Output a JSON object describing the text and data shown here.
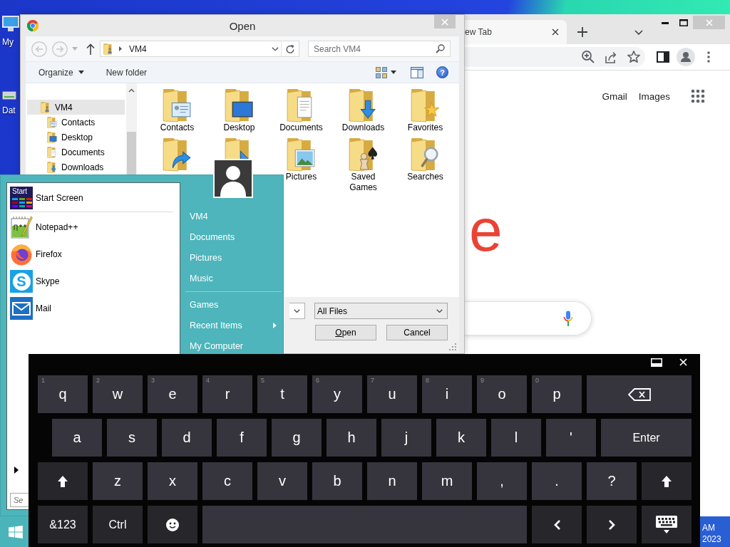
{
  "desktop": {
    "icons": [
      {
        "label": "My",
        "kind": "monitor"
      },
      {
        "label": "Dat",
        "kind": "drive"
      }
    ]
  },
  "dialog": {
    "title": "Open",
    "nav": [
      {
        "kind": "back",
        "disabled": true
      },
      {
        "kind": "forward",
        "disabled": true
      },
      {
        "kind": "history",
        "disabled": true
      },
      {
        "kind": "up",
        "disabled": false
      }
    ],
    "address": {
      "crumbs": [
        "VM4"
      ]
    },
    "search": {
      "placeholder": "Search VM4"
    },
    "toolbar": {
      "organize": "Organize",
      "new_folder": "New folder",
      "help": "?"
    },
    "tree": [
      {
        "label": "VM4",
        "kind": "person",
        "selected": true,
        "children": [
          {
            "label": "Contacts",
            "kind": "card",
            "selected": false
          },
          {
            "label": "Desktop",
            "kind": "screen",
            "selected": false
          },
          {
            "label": "Documents",
            "kind": "pages",
            "selected": false
          },
          {
            "label": "Downloads",
            "kind": "arrow-down",
            "selected": false
          }
        ]
      }
    ],
    "folders": [
      {
        "label": "Contacts",
        "kind": "card"
      },
      {
        "label": "Desktop",
        "kind": "screen"
      },
      {
        "label": "Documents",
        "kind": "pages"
      },
      {
        "label": "Downloads",
        "kind": "arrow-down"
      },
      {
        "label": "Favorites",
        "kind": "star"
      },
      {
        "kind": "arrow-curve"
      },
      {
        "kind": "cursor"
      },
      {
        "label": "Pictures",
        "kind": "photo"
      },
      {
        "label": "Saved Games",
        "kind": "chess"
      },
      {
        "label": "Searches",
        "kind": "magnifier"
      }
    ],
    "file_type": "All Files",
    "buttons": [
      {
        "label": "Open",
        "mnemonic": true
      },
      {
        "label": "Cancel",
        "mnemonic": false
      }
    ]
  },
  "browser": {
    "tab": "ew Tab",
    "links": [
      "Gmail",
      "Images"
    ],
    "logo": "e"
  },
  "start_menu": {
    "pinned": [
      [
        {
          "label": "Start Screen",
          "kind": "tiles",
          "icon_text": "Start"
        }
      ],
      [
        {
          "label": "Notepad++",
          "kind": "notepad"
        },
        {
          "label": "Firefox",
          "kind": "globe"
        },
        {
          "label": "Skype",
          "kind": "letter",
          "icon_text": "S"
        },
        {
          "label": "Mail",
          "kind": "envelope"
        }
      ]
    ],
    "search": {
      "placeholder": "Se"
    },
    "places": [
      [
        {
          "label": "VM4",
          "submenu": false
        },
        {
          "label": "Documents",
          "submenu": false
        },
        {
          "label": "Pictures",
          "submenu": false
        },
        {
          "label": "Music",
          "submenu": false
        }
      ],
      [
        {
          "label": "Games",
          "submenu": false
        },
        {
          "label": "Recent Items",
          "submenu": true
        },
        {
          "label": "My Computer",
          "submenu": false
        }
      ]
    ]
  },
  "keyboard": {
    "rows": [
      [
        {
          "label": "q",
          "hint": "1",
          "kind": "char"
        },
        {
          "label": "w",
          "hint": "2",
          "kind": "char"
        },
        {
          "label": "e",
          "hint": "3",
          "kind": "char"
        },
        {
          "label": "r",
          "hint": "4",
          "kind": "char"
        },
        {
          "label": "t",
          "hint": "5",
          "kind": "char"
        },
        {
          "label": "y",
          "hint": "6",
          "kind": "char"
        },
        {
          "label": "u",
          "hint": "7",
          "kind": "char"
        },
        {
          "label": "i",
          "hint": "8",
          "kind": "char"
        },
        {
          "label": "o",
          "hint": "9",
          "kind": "char"
        },
        {
          "label": "p",
          "hint": "0",
          "kind": "char"
        },
        {
          "kind": "backspace"
        }
      ],
      [
        {
          "label": "a",
          "kind": "char"
        },
        {
          "label": "s",
          "kind": "char"
        },
        {
          "label": "d",
          "kind": "char"
        },
        {
          "label": "f",
          "kind": "char"
        },
        {
          "label": "g",
          "kind": "char"
        },
        {
          "label": "h",
          "kind": "char"
        },
        {
          "label": "j",
          "kind": "char"
        },
        {
          "label": "k",
          "kind": "char"
        },
        {
          "label": "l",
          "kind": "char"
        },
        {
          "label": "'",
          "kind": "char"
        },
        {
          "label": "Enter",
          "kind": "enter"
        }
      ],
      [
        {
          "kind": "shift"
        },
        {
          "label": "z",
          "kind": "char"
        },
        {
          "label": "x",
          "kind": "char"
        },
        {
          "label": "c",
          "kind": "char"
        },
        {
          "label": "v",
          "kind": "char"
        },
        {
          "label": "b",
          "kind": "char"
        },
        {
          "label": "n",
          "kind": "char"
        },
        {
          "label": "m",
          "kind": "char"
        },
        {
          "label": ",",
          "kind": "char"
        },
        {
          "label": ".",
          "kind": "char"
        },
        {
          "label": "?",
          "kind": "char"
        },
        {
          "kind": "shift"
        }
      ],
      [
        {
          "label": "&123",
          "kind": "func"
        },
        {
          "label": "Ctrl",
          "kind": "func"
        },
        {
          "kind": "emoji"
        },
        {
          "kind": "space"
        },
        {
          "kind": "left"
        },
        {
          "kind": "right"
        },
        {
          "kind": "hide"
        }
      ]
    ]
  },
  "taskbar": {
    "clock": {
      "time": "AM",
      "date": "2023"
    }
  }
}
